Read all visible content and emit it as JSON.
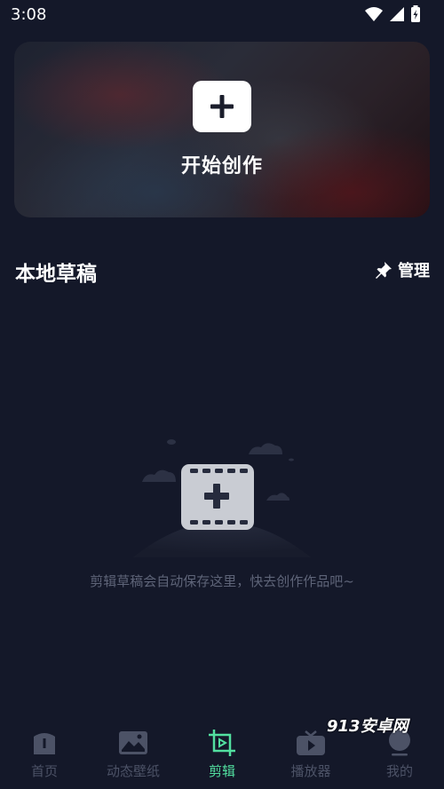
{
  "status_bar": {
    "time": "3:08",
    "icons": [
      "wifi-icon",
      "cellular-icon",
      "battery-charging-icon"
    ]
  },
  "hero": {
    "action_icon": "plus-icon",
    "title": "开始创作"
  },
  "drafts": {
    "title": "本地草稿",
    "manage_icon": "pin-icon",
    "manage_label": "管理",
    "empty_icon": "film-add-icon",
    "empty_text": "剪辑草稿会自动保存这里，快去创作作品吧~"
  },
  "bottom_nav": {
    "items": [
      {
        "label": "首页",
        "icon": "home-icon",
        "active": false
      },
      {
        "label": "动态壁纸",
        "icon": "wallpaper-icon",
        "active": false
      },
      {
        "label": "剪辑",
        "icon": "edit-crop-icon",
        "active": true
      },
      {
        "label": "播放器",
        "icon": "tv-play-icon",
        "active": false
      },
      {
        "label": "我的",
        "icon": "profile-icon",
        "active": false
      }
    ]
  },
  "colors": {
    "background": "#141829",
    "accent": "#52e0a0",
    "inactive": "#4c5266"
  },
  "watermark": "913安卓网"
}
